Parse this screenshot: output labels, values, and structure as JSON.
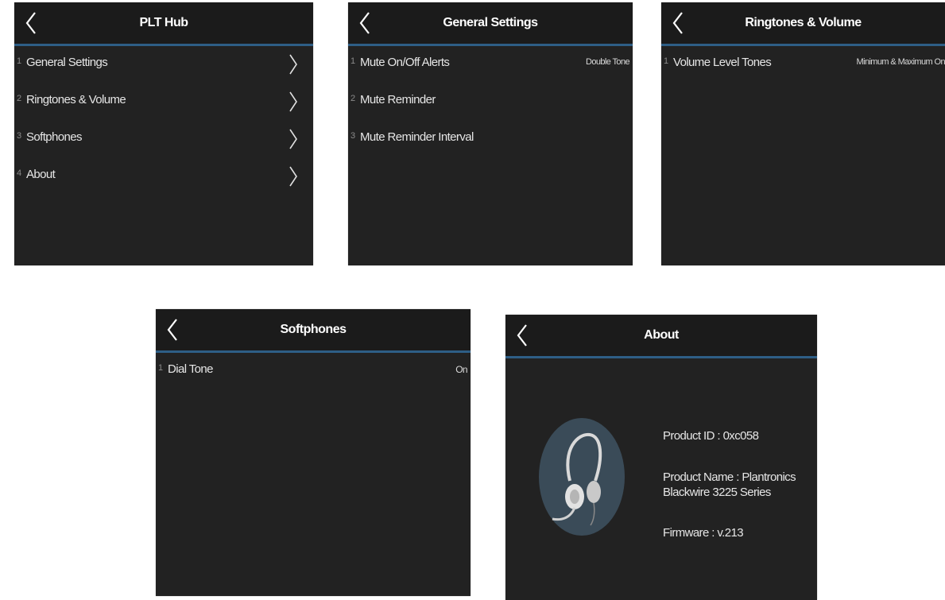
{
  "panels": {
    "plt_hub": {
      "title": "PLT Hub",
      "items": [
        {
          "num": "1",
          "label": "General Settings"
        },
        {
          "num": "2",
          "label": "Ringtones & Volume"
        },
        {
          "num": "3",
          "label": "Softphones"
        },
        {
          "num": "4",
          "label": "About"
        }
      ]
    },
    "general_settings": {
      "title": "General Settings",
      "items": [
        {
          "num": "1",
          "label": "Mute On/Off Alerts",
          "value": "Double Tone"
        },
        {
          "num": "2",
          "label": "Mute Reminder"
        },
        {
          "num": "3",
          "label": "Mute Reminder Interval"
        }
      ]
    },
    "ringtones": {
      "title": "Ringtones & Volume",
      "items": [
        {
          "num": "1",
          "label": "Volume Level Tones",
          "value": "Minimum & Maximum On"
        }
      ]
    },
    "softphones": {
      "title": "Softphones",
      "items": [
        {
          "num": "1",
          "label": "Dial Tone",
          "value": "On"
        }
      ]
    },
    "about": {
      "title": "About",
      "product_id": "Product ID : 0xc058",
      "product_name_line1": "Product Name : Plantronics",
      "product_name_line2": "Blackwire 3225 Series",
      "firmware": "Firmware : v.213"
    }
  },
  "icons": {
    "back": "chevron-left-icon",
    "next": "chevron-right-icon",
    "headset": "headset-icon"
  },
  "colors": {
    "panel_bg": "#222222",
    "header_bg": "#1b1b1b",
    "accent_line": "#2e5e86",
    "avatar_bg": "#3a4b58"
  }
}
